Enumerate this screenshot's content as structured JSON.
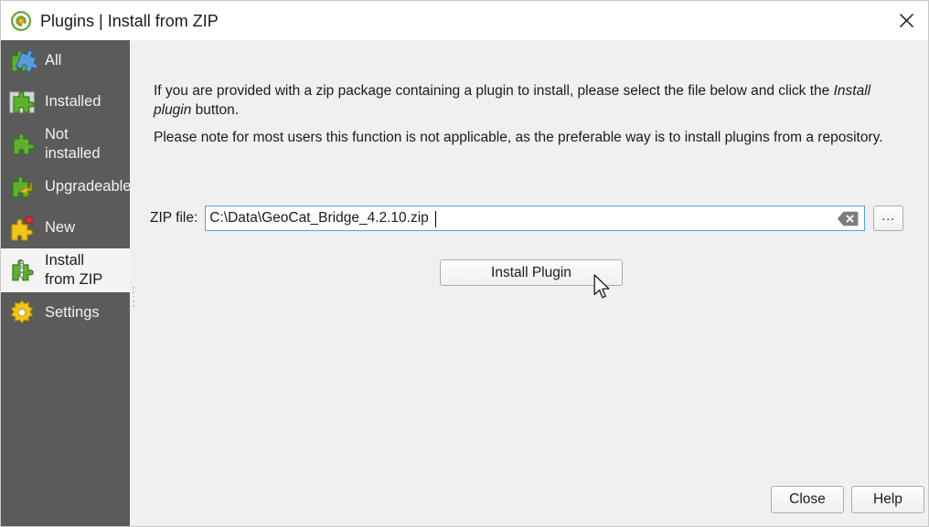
{
  "window": {
    "title": "Plugins | Install from ZIP",
    "logo_icon": "qgis-logo-icon",
    "close_icon": "close-icon"
  },
  "sidebar": {
    "items": [
      {
        "label": "All",
        "icon": "puzzle-all-icon",
        "selected": false
      },
      {
        "label": "Installed",
        "icon": "puzzle-installed-icon",
        "selected": false
      },
      {
        "label": "Not\ninstalled",
        "icon": "puzzle-not-installed-icon",
        "selected": false
      },
      {
        "label": "Upgradeable",
        "icon": "puzzle-upgradeable-icon",
        "selected": false
      },
      {
        "label": "New",
        "icon": "puzzle-new-icon",
        "selected": false
      },
      {
        "label": "Install\nfrom ZIP",
        "icon": "puzzle-zip-icon",
        "selected": true
      },
      {
        "label": "Settings",
        "icon": "gear-icon",
        "selected": false
      }
    ]
  },
  "main": {
    "paragraph1_before": "If you are provided with a zip package containing a plugin to install, please select the file below and click the ",
    "paragraph1_italic": "Install plugin",
    "paragraph1_after": " button.",
    "paragraph2": "Please note for most users this function is not applicable, as the preferable way is to install plugins from a repository.",
    "zip_label": "ZIP file:",
    "zip_value": "C:\\Data\\GeoCat_Bridge_4.2.10.zip",
    "zip_placeholder": "",
    "clear_icon": "clear-text-icon",
    "browse_label": "...",
    "install_button": "Install Plugin"
  },
  "footer": {
    "close_label": "Close",
    "help_label": "Help"
  },
  "colors": {
    "sidebar_bg": "#5b5b5b",
    "content_bg": "#f0f0f0",
    "selected_item_bg": "#f4f4f4",
    "focus_border": "#4ea6e8",
    "text": "#1b1b1b"
  }
}
